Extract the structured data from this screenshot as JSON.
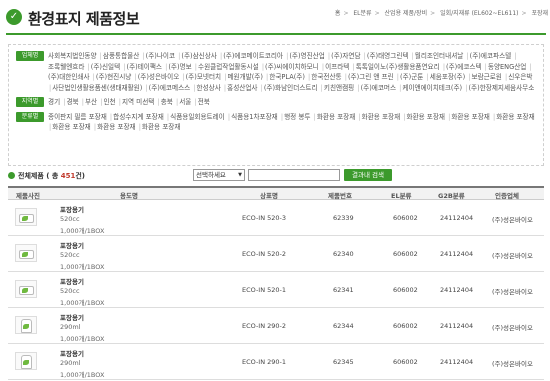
{
  "header": {
    "title": "환경표지 제품정보",
    "breadcrumb": [
      "홈",
      "EL분류",
      "산업용 제품/장비",
      "일회/지재류 (EL602~EL611)",
      "포장재"
    ]
  },
  "filters": {
    "groups": [
      {
        "tag": "업체명",
        "items": [
          "사회복지법인동양",
          "삼풍통합물산",
          "(주)나이코",
          "(주)삼신상사",
          "(주)에코메이트코리아",
          "(주)영진산업",
          "(주)자연담",
          "(주)태영그린텍",
          "월리조인터내셔날",
          "(주)에코파스텔",
          "조록웰엔흐라",
          "(주)신일텍",
          "(주)테이팩스",
          "(주)명보",
          "수원클럽작업활동시설",
          "(주)씨에이치하모니",
          "이프라텍",
          "톡톡일이노(주)생활용품연요리",
          "(주)에코스텍",
          "동양ENG산업",
          "(주)대한인쇄사",
          "(주)현진시냥",
          "(주)성은바이오",
          "(주)모넷터치",
          "메원개발(주)",
          "한국PLA(주)",
          "한국전산통",
          "(주)그린 앤 프린",
          "(주)군툰",
          "세움포장(주)",
          "보람근로원",
          "신우은박",
          "사단법인생활용품센(생태재활원)",
          "(주)에코메스스",
          "한성상사",
          "홍성산업사",
          "(주)화남인더스트리",
          "키친앤캠핑",
          "(주)에코머스",
          "케이앤에이치테크(주)",
          "(주)한장제지세움사무소"
        ]
      },
      {
        "tag": "지역별",
        "items": [
          "경기",
          "경북",
          "부산",
          "인천",
          "지역 미선택",
          "충북",
          "서울",
          "전북"
        ]
      },
      {
        "tag": "분류별",
        "items": [
          "종이판지 필름 포장재",
          "합성수지계 포장재",
          "식품용일회용트레이",
          "식품용1차포장재",
          "행정 봉투",
          "화환용 포장재",
          "화환용 포장재",
          "화환용 포장재",
          "화환용 포장재",
          "화환용 포장재",
          "화환용 포장재",
          "화환용 포장재",
          "화환용 포장재"
        ]
      }
    ]
  },
  "search": {
    "total_prefix": "전체제품 ( 총",
    "total_count": "451",
    "total_suffix": "건)",
    "select_value": "선택하세요",
    "input_value": "",
    "button_label": "결과내 검색"
  },
  "table": {
    "headers": [
      "제품사진",
      "용도명",
      "상표명",
      "제품번호",
      "EL분류",
      "G2B분류",
      "인증업체"
    ],
    "rows": [
      {
        "name": "포장용기",
        "size": "520cc",
        "pack": "1,000개/1BOX",
        "brand": "ECO-IN 520-3",
        "product_no": "62339",
        "el": "606002",
        "g2b": "24112404",
        "company": "(주)성은바이오"
      },
      {
        "name": "포장용기",
        "size": "520cc",
        "pack": "1,000개/1BOX",
        "brand": "ECO-IN 520-2",
        "product_no": "62340",
        "el": "606002",
        "g2b": "24112404",
        "company": "(주)성은바이오"
      },
      {
        "name": "포장용기",
        "size": "520cc",
        "pack": "1,000개/1BOX",
        "brand": "ECO-IN 520-1",
        "product_no": "62341",
        "el": "606002",
        "g2b": "24112404",
        "company": "(주)성은바이오"
      },
      {
        "name": "포장용기",
        "size": "290ml",
        "pack": "1,000개/1BOX",
        "brand": "ECO-IN 290-2",
        "product_no": "62344",
        "el": "606002",
        "g2b": "24112404",
        "company": "(주)성은바이오"
      },
      {
        "name": "포장용기",
        "size": "290ml",
        "pack": "1,000개/1BOX",
        "brand": "ECO-IN 290-1",
        "product_no": "62345",
        "el": "606002",
        "g2b": "24112404",
        "company": "(주)성은바이오"
      }
    ]
  },
  "colors": {
    "accent": "#3c9a2c",
    "count": "#c0392b"
  }
}
